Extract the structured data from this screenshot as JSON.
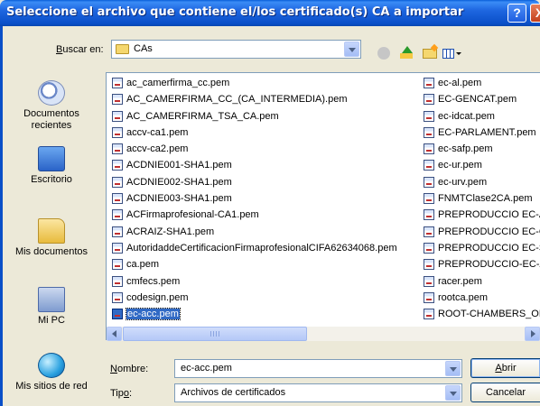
{
  "window": {
    "title": "Seleccione el archivo que contiene el/los certificado(s) CA a importar",
    "help_glyph": "?",
    "close_glyph": "X"
  },
  "toolbar": {
    "lookin_label_pre": "",
    "lookin_label_key": "B",
    "lookin_label_post": "uscar en:",
    "lookin_value": "CAs"
  },
  "places": [
    {
      "label": "Documentos recientes",
      "icon": "recent-documents-icon"
    },
    {
      "label": "Escritorio",
      "icon": "desktop-icon"
    },
    {
      "label": "Mis documentos",
      "icon": "my-documents-icon"
    },
    {
      "label": "Mi PC",
      "icon": "my-computer-icon"
    },
    {
      "label": "Mis sitios de red",
      "icon": "network-places-icon"
    }
  ],
  "files_col1": [
    "ac_camerfirma_cc.pem",
    "AC_CAMERFIRMA_CC_(CA_INTERMEDIA).pem",
    "AC_CAMERFIRMA_TSA_CA.pem",
    "accv-ca1.pem",
    "accv-ca2.pem",
    "ACDNIE001-SHA1.pem",
    "ACDNIE002-SHA1.pem",
    "ACDNIE003-SHA1.pem",
    "ACFirmaprofesional-CA1.pem",
    "ACRAIZ-SHA1.pem",
    "AutoridaddeCertificacionFirmaprofesionalCIFA62634068.pem",
    "ca.pem",
    "cmfecs.pem",
    "codesign.pem",
    "ec-acc.pem"
  ],
  "files_col2": [
    "ec-al.pem",
    "EC-GENCAT.pem",
    "ec-idcat.pem",
    "EC-PARLAMENT.pem",
    "ec-safp.pem",
    "ec-ur.pem",
    "ec-urv.pem",
    "FNMTClase2CA.pem",
    "PREPRODUCCIO EC-A",
    "PREPRODUCCIO EC-G",
    "PREPRODUCCIO EC-S",
    "PREPRODUCCIO-EC-A",
    "racer.pem",
    "rootca.pem",
    "ROOT-CHAMBERS_OF"
  ],
  "selected_file": "ec-acc.pem",
  "filename": {
    "label_key": "N",
    "label_post": "ombre:",
    "value": "ec-acc.pem"
  },
  "filetype": {
    "label_pre": "Tip",
    "label_key": "o",
    "label_post": ":",
    "value": "Archivos de certificados"
  },
  "buttons": {
    "open_key": "A",
    "open_post": "brir",
    "cancel": "Cancelar"
  },
  "colors": {
    "titlebar": "#0a4fc8",
    "selection": "#316ac5",
    "dialog_bg": "#ece9d8"
  }
}
